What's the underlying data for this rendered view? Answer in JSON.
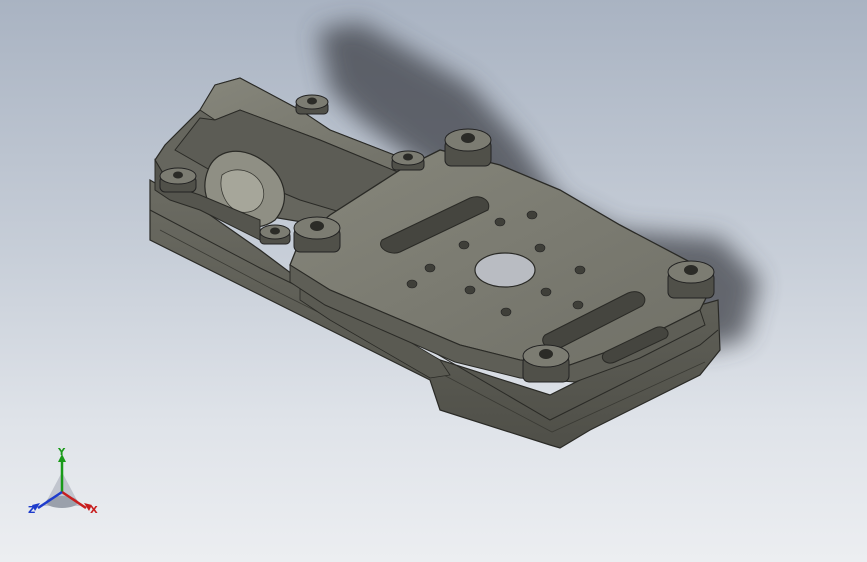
{
  "viewport": {
    "background_top": "#a9b3c2",
    "background_bottom": "#eceef1",
    "model": {
      "part": "motor-mount-bracket",
      "body_color": "#6f6f66",
      "top_face_color": "#7d7d73",
      "edge_color": "#2a2a26",
      "mounting_holes": 8,
      "center_hole": 1,
      "slots": 3,
      "socket_cap_screws": 8
    }
  },
  "triad": {
    "x_label": "X",
    "y_label": "Y",
    "z_label": "Z",
    "x_color": "#c81e1e",
    "y_color": "#1a9a1a",
    "z_color": "#1e3ccc"
  }
}
